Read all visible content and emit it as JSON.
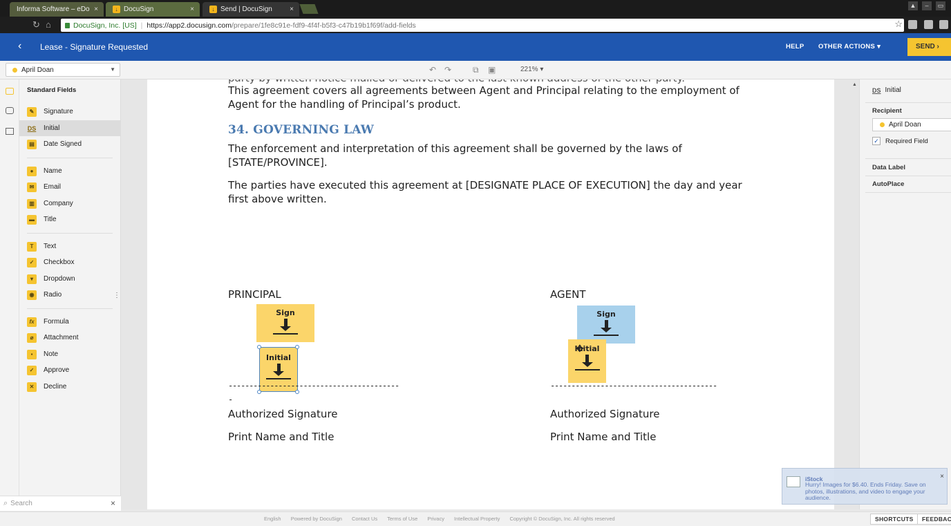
{
  "browser": {
    "tabs": [
      {
        "label": "Informa Software – eDo",
        "close": "×"
      },
      {
        "label": "DocuSign",
        "close": "×"
      },
      {
        "label": "Send | DocuSign",
        "close": "×"
      }
    ],
    "url": {
      "secure_label": "DocuSign, Inc. [US]",
      "host": "https://app2.docusign.com",
      "path": "/prepare/1fe8c91e-fdf9-4f4f-b5f3-c47b19b1f69f/add-fields"
    }
  },
  "header": {
    "title": "Lease - Signature Requested",
    "help": "HELP",
    "other_actions": "OTHER ACTIONS ▾",
    "send": "SEND  ›"
  },
  "toolbar": {
    "recipient": "April Doan",
    "zoom": "221% ▾"
  },
  "left_panel": {
    "heading": "Standard Fields",
    "groups": [
      [
        {
          "label": "Signature",
          "icon": "pen-icon",
          "glyph": "✎"
        },
        {
          "label": "Initial",
          "icon": "initial-ds-icon",
          "glyph": "DS"
        },
        {
          "label": "Date Signed",
          "icon": "calendar-icon",
          "glyph": "▤"
        }
      ],
      [
        {
          "label": "Name",
          "icon": "person-icon",
          "glyph": "●"
        },
        {
          "label": "Email",
          "icon": "envelope-icon",
          "glyph": "✉"
        },
        {
          "label": "Company",
          "icon": "building-icon",
          "glyph": "▥"
        },
        {
          "label": "Title",
          "icon": "briefcase-icon",
          "glyph": "▬"
        }
      ],
      [
        {
          "label": "Text",
          "icon": "text-t-icon",
          "glyph": "T"
        },
        {
          "label": "Checkbox",
          "icon": "checkbox-icon",
          "glyph": "✓"
        },
        {
          "label": "Dropdown",
          "icon": "dropdown-icon",
          "glyph": "▾"
        },
        {
          "label": "Radio",
          "icon": "radio-icon",
          "glyph": "◉"
        }
      ],
      [
        {
          "label": "Formula",
          "icon": "formula-fx-icon",
          "glyph": "fx"
        },
        {
          "label": "Attachment",
          "icon": "paperclip-icon",
          "glyph": "⌀"
        },
        {
          "label": "Note",
          "icon": "note-icon",
          "glyph": "▪"
        },
        {
          "label": "Approve",
          "icon": "approve-check-icon",
          "glyph": "✓"
        },
        {
          "label": "Decline",
          "icon": "decline-x-icon",
          "glyph": "✕"
        }
      ]
    ],
    "search_placeholder": "Search",
    "search_clear": "×"
  },
  "document": {
    "para_cut": "party by written notice mailed or delivered to the last known address of the other party.",
    "para_top": "This agreement covers all agreements between Agent and Principal relating to the employment of Agent for the handling of Principal’s product.",
    "section_heading": "34.   GOVERNING LAW",
    "para_law": "The enforcement and interpretation of this agreement shall be governed by the laws of [STATE/PROVINCE].",
    "para_exec": "The parties have executed this agreement at [DESIGNATE PLACE OF EXECUTION] the day and year first above written.",
    "principal": "PRINCIPAL",
    "agent": "AGENT",
    "dashes_left": "-----------------------------------------",
    "dash_extra": "-",
    "dashes_right": "----------------------------------------",
    "auth_sig": "Authorized Signature",
    "print_name": "Print Name and Title",
    "tags": {
      "sign_label": "Sign",
      "initial_label": "Initial"
    }
  },
  "right_panel": {
    "field_type_ds": "DS",
    "field_type": "Initial",
    "recipient_heading": "Recipient",
    "recipient_value": "April Doan",
    "required_label": "Required Field",
    "required_check": "✓",
    "data_label": "Data Label",
    "autoplace": "AutoPlace"
  },
  "toast": {
    "title": "iStock",
    "message": "Hurry! Images for $6.40. Ends Friday. Save on photos, illustrations, and video to engage your audience.",
    "close": "×"
  },
  "footer": {
    "links": [
      "English",
      "Powered by DocuSign",
      "Contact Us",
      "Terms of Use",
      "Privacy",
      "Intellectual Property",
      "Copyright © DocuSign, Inc. All rights reserved"
    ],
    "shortcuts": "SHORTCUTS",
    "feedback": "FEEDBACK"
  },
  "colors": {
    "header_blue": "#1f57b0",
    "send_yellow": "#f5c430",
    "tag_yellow": "#fbd56a",
    "tag_blue": "#a8d1ec",
    "heading_blue": "#4a7ab0"
  }
}
